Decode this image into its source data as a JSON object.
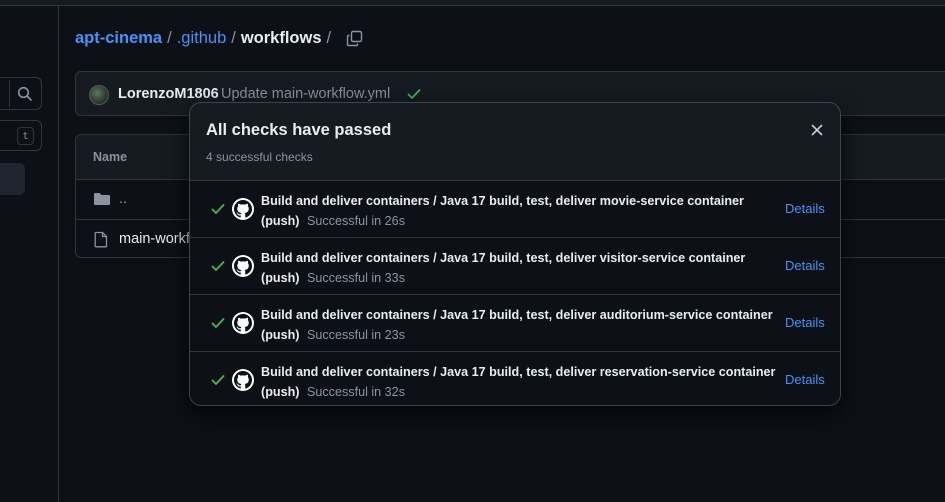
{
  "breadcrumb": {
    "repo": "apt-cinema",
    "folder": ".github",
    "current": "workflows",
    "sep1": "/",
    "sep2": "/",
    "sep3": "/"
  },
  "sidebar": {
    "filter_shortcut": "t"
  },
  "commit": {
    "author": "LorenzoM1806",
    "message": "Update main-workflow.yml"
  },
  "files": {
    "header_name": "Name",
    "rows": [
      {
        "label": "..",
        "type": "folder"
      },
      {
        "label": "main-workfl",
        "type": "file"
      }
    ]
  },
  "checks_popover": {
    "title": "All checks have passed",
    "subtitle": "4 successful checks",
    "items": [
      {
        "title": "Build and deliver containers / Java 17 build, test, deliver movie-service container",
        "event": "(push)",
        "status": "Successful in 26s",
        "details": "Details"
      },
      {
        "title": "Build and deliver containers / Java 17 build, test, deliver visitor-service container",
        "event": "(push)",
        "status": "Successful in 33s",
        "details": "Details"
      },
      {
        "title": "Build and deliver containers / Java 17 build, test, deliver auditorium-service container",
        "event": "(push)",
        "status": "Successful in 23s",
        "details": "Details"
      },
      {
        "title": "Build and deliver containers / Java 17 build, test, deliver reservation-service container",
        "event": "(push)",
        "status": "Successful in 32s",
        "details": "Details"
      }
    ]
  },
  "icons": {
    "search": "search-icon",
    "copy": "copy-icon",
    "check": "check-icon",
    "close": "close-icon",
    "folder": "folder-icon",
    "file": "file-icon",
    "github": "github-logo-icon"
  },
  "colors": {
    "background": "#0d1117",
    "surface": "#161b22",
    "border": "#30363d",
    "link": "#4493f8",
    "success": "#3fb950",
    "muted": "#8b949e"
  }
}
